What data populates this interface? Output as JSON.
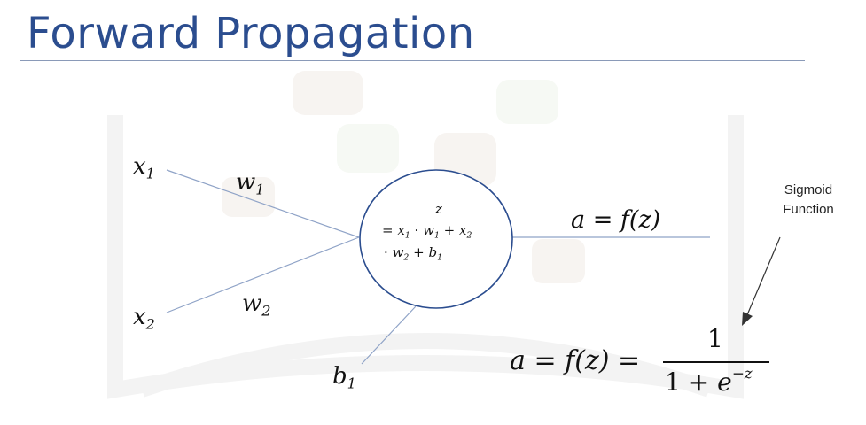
{
  "slide": {
    "title": "Forward Propagation"
  },
  "diagram": {
    "inputs": [
      {
        "name": "x",
        "index": "1"
      },
      {
        "name": "x",
        "index": "2"
      }
    ],
    "weights": [
      {
        "name": "w",
        "index": "1"
      },
      {
        "name": "w",
        "index": "2"
      }
    ],
    "bias": {
      "name": "b",
      "index": "1"
    },
    "neuron": {
      "z": "z",
      "formula_line2": {
        "eq": "=",
        "x1": "x",
        "x1_sub": "1",
        "dot1": "·",
        "w1": "w",
        "w1_sub": "1",
        "plus1": "+",
        "x2": "x",
        "x2_sub": "2"
      },
      "formula_line3": {
        "dot2": "·",
        "w2": "w",
        "w2_sub": "2",
        "plus2": "+",
        "b1": "b",
        "b1_sub": "1"
      }
    },
    "output": {
      "a": "a",
      "eq": "=",
      "f": "f",
      "arg": "(z)"
    },
    "annotation": {
      "line1": "Sigmoid",
      "line2": "Function"
    },
    "sigmoid": {
      "a": "a",
      "eq1": "=",
      "f": "f",
      "arg": "(z)",
      "eq2": "=",
      "numerator": "1",
      "denominator_one": "1",
      "denominator_plus": "+",
      "e": "e",
      "exponent": "−z"
    }
  },
  "colors": {
    "title": "#2b4d8f",
    "rule": "#8a9ab8",
    "edges": "#8fa3c7",
    "neuron_stroke": "#2b4d8f",
    "arrow": "#333333"
  }
}
